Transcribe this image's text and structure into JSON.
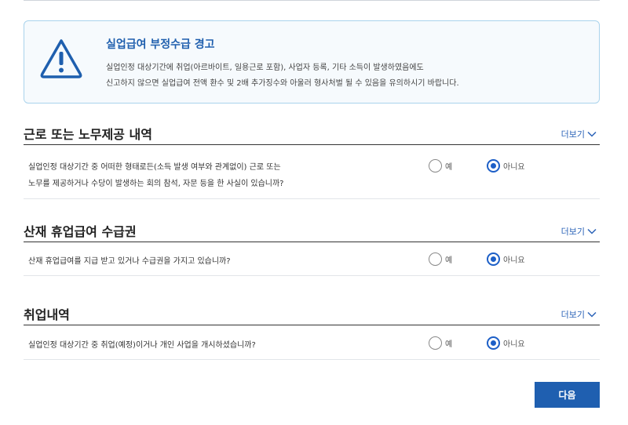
{
  "warning": {
    "icon": "warning-triangle-icon",
    "title": "실업급여 부정수급 경고",
    "line1": "실업인정 대상기간에 취업(아르바이트, 일용근로 포함), 사업자 등록, 기타 소득이 발생하였음에도",
    "line2": "신고하지 않으면 실업급여 전액 환수 및 2배 추가징수와 아울러 형사처벌 될 수 있음을 유의하시기 바랍니다.",
    "accent_color": "#1f5fae",
    "border_color": "#a9d3ec"
  },
  "more_label": "더보기",
  "yes_label": "예",
  "no_label": "아니요",
  "sections": [
    {
      "title": "근로 또는 노무제공 내역",
      "question_line1": "실업인정 대상기간 중 어떠한 형태로든(소득 발생 여부와 관계없이) 근로 또는",
      "question_line2": "노무를 제공하거나 수당이 발생하는 회의 참석, 자문 등을 한 사실이 있습니까?",
      "selected": "아니요"
    },
    {
      "title": "산재 휴업급여 수급권",
      "question_line1": "산재 휴업급여를 지급 받고 있거나 수급권을 가지고 있습니까?",
      "selected": "아니요"
    },
    {
      "title": "취업내역",
      "question_line1": "실업인정 대상기간 중 취업(예정)이거나 개인 사업을 개시하셨습니까?",
      "selected": "아니요"
    }
  ],
  "next_button": "다음",
  "primary_color": "#1f5fb0"
}
